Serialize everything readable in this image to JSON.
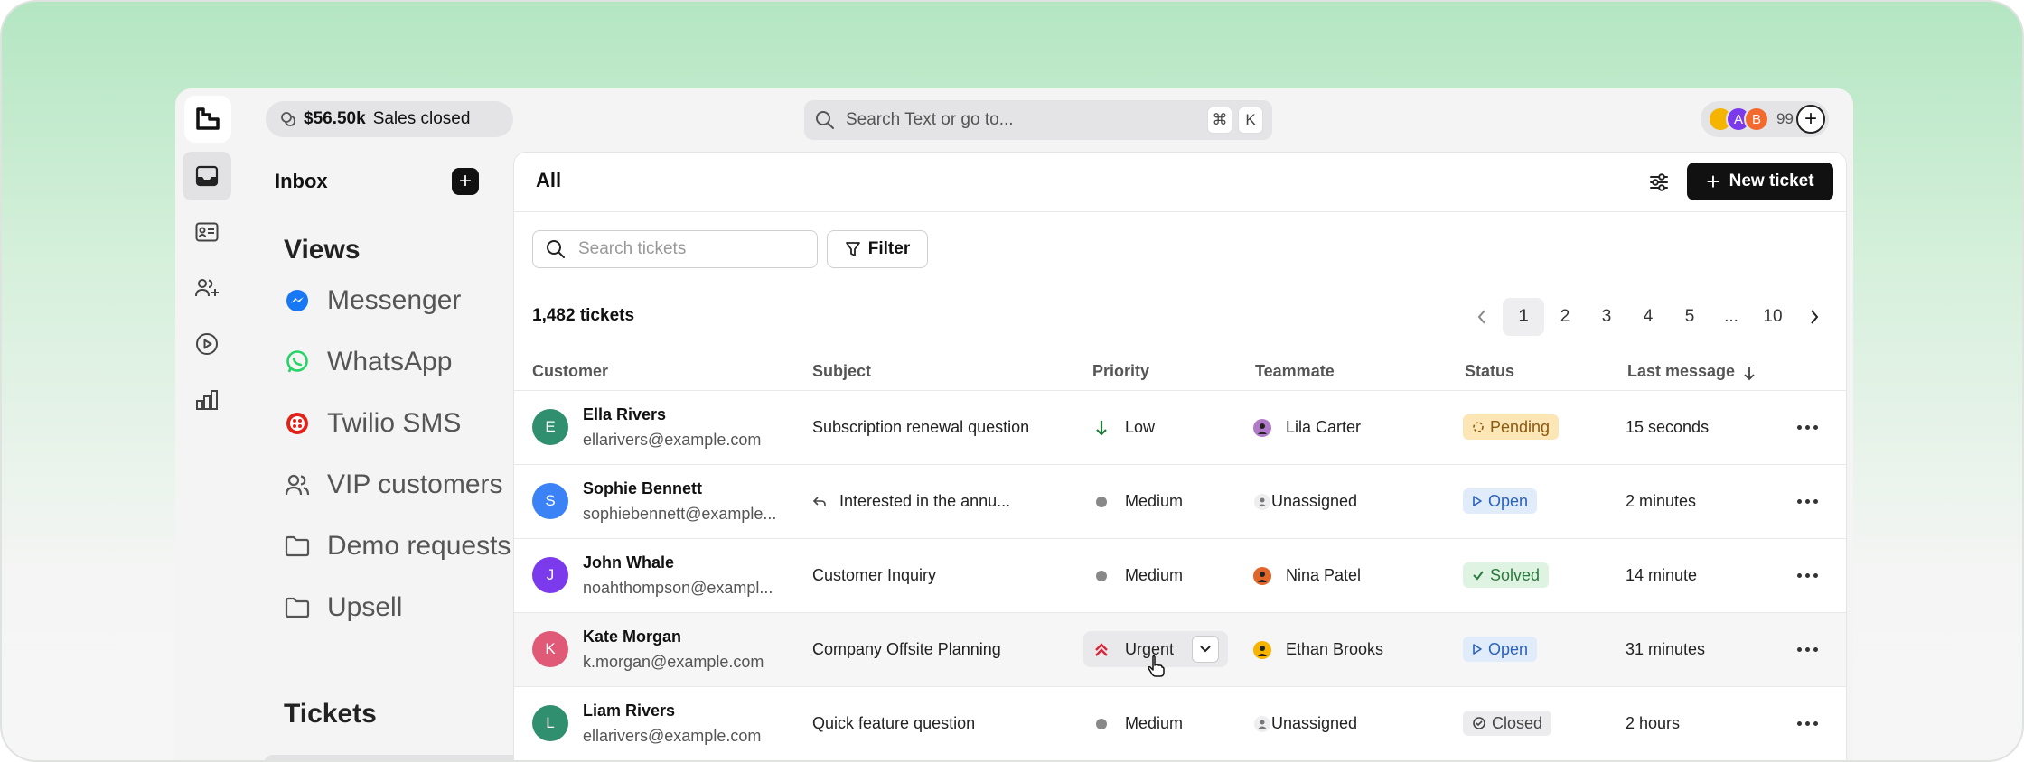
{
  "topbar": {
    "sales_amount": "$56.50k",
    "sales_label": "Sales closed",
    "search_placeholder": "Search Text or go to...",
    "shortcut_cmd": "⌘",
    "shortcut_key": "K",
    "avatars": [
      {
        "letter": "",
        "color": "#f4b400"
      },
      {
        "letter": "A",
        "color": "#7c3aed"
      },
      {
        "letter": "B",
        "color": "#f26a2e"
      }
    ],
    "avatar_count": "99"
  },
  "sidebar": {
    "inbox_title": "Inbox",
    "views_title": "Views",
    "views": [
      {
        "label": "Messenger",
        "icon": "messenger-icon",
        "color": "#1877f2"
      },
      {
        "label": "WhatsApp",
        "icon": "whatsapp-icon",
        "color": "#25d366"
      },
      {
        "label": "Twilio SMS",
        "icon": "twilio-icon",
        "color": "#e2231a"
      },
      {
        "label": "VIP customers",
        "icon": "users-icon",
        "color": "#555555"
      },
      {
        "label": "Demo requests",
        "icon": "folder-icon",
        "color": "#555555"
      },
      {
        "label": "Upsell",
        "icon": "folder-icon",
        "color": "#555555"
      }
    ],
    "tickets_title": "Tickets"
  },
  "main": {
    "title": "All",
    "new_ticket_label": "New ticket",
    "search_placeholder": "Search tickets",
    "filter_label": "Filter",
    "ticket_count": "1,482 tickets",
    "pages": [
      "1",
      "2",
      "3",
      "4",
      "5",
      "...",
      "10"
    ],
    "current_page": "1",
    "columns": {
      "customer": "Customer",
      "subject": "Subject",
      "priority": "Priority",
      "teammate": "Teammate",
      "status": "Status",
      "last_message": "Last message"
    },
    "rows": [
      {
        "initial": "E",
        "avatar_color": "#2f8f6f",
        "name": "Ella Rivers",
        "email": "ellarivers@example.com",
        "subject": "Subscription renewal question",
        "reply_icon": false,
        "priority": "Low",
        "priority_icon": "arrow-down-icon",
        "teammate": "Lila Carter",
        "teammate_color": "#b07ac8",
        "status": "Pending",
        "status_kind": "pending",
        "last_message": "15 seconds"
      },
      {
        "initial": "S",
        "avatar_color": "#3b82f6",
        "name": "Sophie Bennett",
        "email": "sophiebennett@example...",
        "subject": "Interested in the annu...",
        "reply_icon": true,
        "priority": "Medium",
        "priority_icon": "dot-icon",
        "teammate": "Unassigned",
        "teammate_color": "#e5e5e7",
        "status": "Open",
        "status_kind": "open",
        "last_message": "2 minutes"
      },
      {
        "initial": "J",
        "avatar_color": "#7c3aed",
        "name": "John Whale",
        "email": "noahthompson@exampl...",
        "subject": "Customer Inquiry",
        "reply_icon": false,
        "priority": "Medium",
        "priority_icon": "dot-icon",
        "teammate": "Nina Patel",
        "teammate_color": "#e0662b",
        "status": "Solved",
        "status_kind": "solved",
        "last_message": "14 minute"
      },
      {
        "initial": "K",
        "avatar_color": "#e05a78",
        "name": "Kate Morgan",
        "email": "k.morgan@example.com",
        "subject": "Company Offsite Planning",
        "reply_icon": false,
        "priority": "Urgent",
        "priority_icon": "double-chevron-up-icon",
        "teammate": "Ethan Brooks",
        "teammate_color": "#f4b400",
        "status": "Open",
        "status_kind": "open",
        "last_message": "31 minutes"
      },
      {
        "initial": "L",
        "avatar_color": "#2f8f6f",
        "name": "Liam Rivers",
        "email": "ellarivers@example.com",
        "subject": "Quick feature question",
        "reply_icon": false,
        "priority": "Medium",
        "priority_icon": "dot-icon",
        "teammate": "Unassigned",
        "teammate_color": "#e5e5e7",
        "status": "Closed",
        "status_kind": "closed",
        "last_message": "2 hours"
      }
    ]
  }
}
